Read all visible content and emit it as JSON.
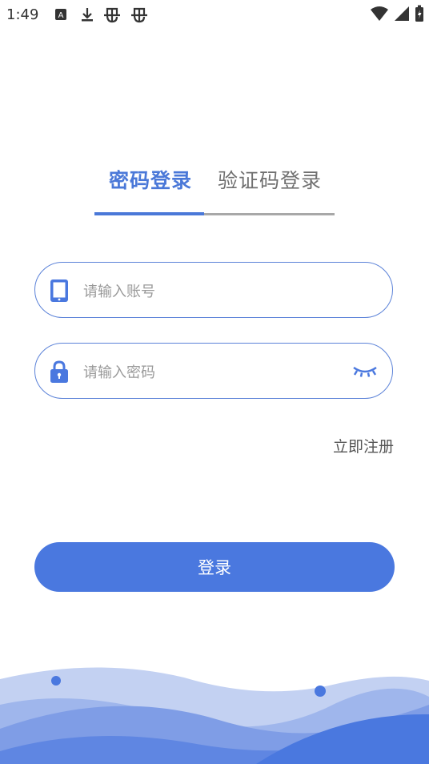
{
  "status_bar": {
    "time": "1:49",
    "icons": [
      "a-notification-icon",
      "download-icon",
      "bug-icon",
      "bug-icon",
      "wifi-icon",
      "signal-icon",
      "battery-charging-icon"
    ]
  },
  "tabs": [
    {
      "label": "密码登录",
      "active": true
    },
    {
      "label": "验证码登录",
      "active": false
    }
  ],
  "form": {
    "account_placeholder": "请输入账号",
    "account_value": "",
    "password_placeholder": "请输入密码",
    "password_value": ""
  },
  "register_link": "立即注册",
  "login_button": "登录",
  "colors": {
    "accent": "#4a78df",
    "tab_active": "#4a78d8",
    "tab_inactive": "#707070",
    "wave_light": "#b3c5ee",
    "wave_mid": "#7e9de6",
    "wave_dark": "#4a78df"
  }
}
